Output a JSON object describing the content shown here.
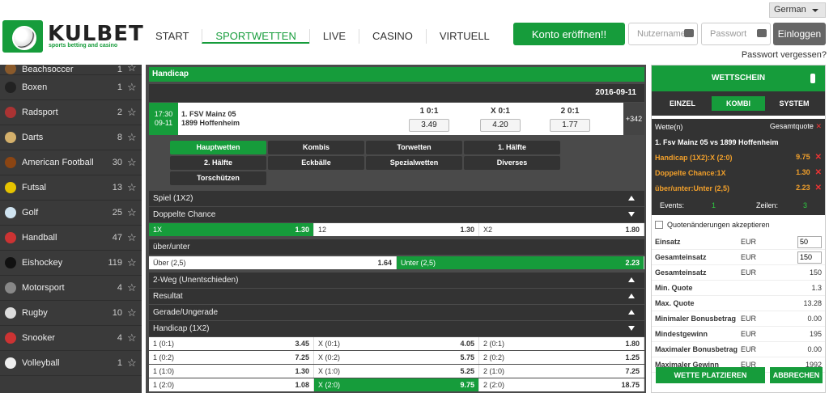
{
  "header": {
    "logo_text": "KULBET",
    "logo_tagline": "sports betting and casino",
    "nav": [
      {
        "label": "START",
        "active": false
      },
      {
        "label": "SPORTWETTEN",
        "active": true
      },
      {
        "label": "LIVE",
        "active": false
      },
      {
        "label": "CASINO",
        "active": false
      },
      {
        "label": "VIRTUELL",
        "active": false
      }
    ],
    "open_account": "Konto eröffnen!!",
    "username_placeholder": "Nutzername",
    "password_placeholder": "Passwort",
    "login_button": "Einloggen",
    "language": "German",
    "forgot_password": "Passwort vergessen?"
  },
  "sidebar": {
    "sports": [
      {
        "name": "Beachsoccer",
        "count": "1",
        "icon": "beachsoccer-icon",
        "color": "#8a5a2b"
      },
      {
        "name": "Boxen",
        "count": "1",
        "icon": "boxing-icon",
        "color": "#222222"
      },
      {
        "name": "Radsport",
        "count": "2",
        "icon": "cycling-icon",
        "color": "#a33"
      },
      {
        "name": "Darts",
        "count": "8",
        "icon": "darts-icon",
        "color": "#d4b06b"
      },
      {
        "name": "American Football",
        "count": "30",
        "icon": "american-football-icon",
        "color": "#8b4513"
      },
      {
        "name": "Futsal",
        "count": "13",
        "icon": "futsal-icon",
        "color": "#e6c300"
      },
      {
        "name": "Golf",
        "count": "25",
        "icon": "golf-icon",
        "color": "#cfe3f0"
      },
      {
        "name": "Handball",
        "count": "47",
        "icon": "handball-icon",
        "color": "#c33"
      },
      {
        "name": "Eishockey",
        "count": "119",
        "icon": "icehockey-icon",
        "color": "#111111"
      },
      {
        "name": "Motorsport",
        "count": "4",
        "icon": "motorsport-icon",
        "color": "#888888"
      },
      {
        "name": "Rugby",
        "count": "10",
        "icon": "rugby-icon",
        "color": "#dddddd"
      },
      {
        "name": "Snooker",
        "count": "4",
        "icon": "snooker-icon",
        "color": "#c33"
      },
      {
        "name": "Volleyball",
        "count": "1",
        "icon": "volleyball-icon",
        "color": "#eeeeee"
      }
    ]
  },
  "main": {
    "title": "Handicap",
    "date": "2016-09-11",
    "match": {
      "time": "17:30",
      "date": "09-11",
      "home": "1. FSV Mainz 05",
      "away": "1899 Hoffenheim",
      "odds": [
        {
          "label": "1 0:1",
          "value": "3.49"
        },
        {
          "label": "X 0:1",
          "value": "4.20"
        },
        {
          "label": "2 0:1",
          "value": "1.77"
        }
      ],
      "more": "+342"
    },
    "tabs": [
      {
        "label": "Hauptwetten",
        "active": true
      },
      {
        "label": "Kombis",
        "active": false
      },
      {
        "label": "Torwetten",
        "active": false
      },
      {
        "label": "1. Hälfte",
        "active": false
      },
      {
        "label": "2. Hälfte",
        "active": false
      },
      {
        "label": "Eckbälle",
        "active": false
      },
      {
        "label": "Spezialwetten",
        "active": false
      },
      {
        "label": "Diverses",
        "active": false
      },
      {
        "label": "Torschützen",
        "active": false
      }
    ],
    "markets": {
      "spiel": "Spiel (1X2)",
      "doppelte": "Doppelte Chance",
      "doppelte_odds": [
        {
          "label": "1X",
          "value": "1.30",
          "selected": true
        },
        {
          "label": "12",
          "value": "1.30",
          "selected": false
        },
        {
          "label": "X2",
          "value": "1.80",
          "selected": false
        }
      ],
      "ueber": "über/unter",
      "ueber_odds": [
        {
          "label": "Über (2,5)",
          "value": "1.64",
          "selected": false
        },
        {
          "label": "Unter (2,5)",
          "value": "2.23",
          "selected": true
        }
      ],
      "zweiweg": "2-Weg (Unentschieden)",
      "resultat": "Resultat",
      "gerade": "Gerade/Ungerade",
      "handicap": "Handicap (1X2)",
      "handicap_rows": [
        [
          {
            "label": "1 (0:1)",
            "value": "3.45",
            "selected": false
          },
          {
            "label": "X (0:1)",
            "value": "4.05",
            "selected": false
          },
          {
            "label": "2 (0:1)",
            "value": "1.80",
            "selected": false
          }
        ],
        [
          {
            "label": "1 (0:2)",
            "value": "7.25",
            "selected": false
          },
          {
            "label": "X (0:2)",
            "value": "5.75",
            "selected": false
          },
          {
            "label": "2 (0:2)",
            "value": "1.25",
            "selected": false
          }
        ],
        [
          {
            "label": "1 (1:0)",
            "value": "1.30",
            "selected": false
          },
          {
            "label": "X (1:0)",
            "value": "5.25",
            "selected": false
          },
          {
            "label": "2 (1:0)",
            "value": "7.25",
            "selected": false
          }
        ],
        [
          {
            "label": "1 (2:0)",
            "value": "1.08",
            "selected": false
          },
          {
            "label": "X (2:0)",
            "value": "9.75",
            "selected": true
          },
          {
            "label": "2 (2:0)",
            "value": "18.75",
            "selected": false
          }
        ]
      ]
    }
  },
  "betslip": {
    "title": "WETTSCHEIN",
    "tabs": [
      {
        "label": "EINZEL",
        "active": false
      },
      {
        "label": "KOMBI",
        "active": true
      },
      {
        "label": "SYSTEM",
        "active": false
      }
    ],
    "header_left": "Wette(n)",
    "header_right": "Gesamtquote",
    "match": "1. Fsv Mainz 05 vs 1899 Hoffenheim",
    "selections": [
      {
        "label": "Handicap (1X2):X (2:0)",
        "value": "9.75"
      },
      {
        "label": "Doppelte Chance:1X",
        "value": "1.30"
      },
      {
        "label": "über/unter:Unter (2,5)",
        "value": "2.23"
      }
    ],
    "events_label": "Events:",
    "events_value": "1",
    "lines_label": "Zeilen:",
    "lines_value": "3",
    "accept_changes": "Quotenänderungen akzeptieren",
    "calc": [
      {
        "label": "Einsatz",
        "unit": "EUR",
        "value": "50",
        "input": true
      },
      {
        "label": "Gesamteinsatz",
        "unit": "EUR",
        "value": "150",
        "input": true
      },
      {
        "label": "Gesamteinsatz",
        "unit": "EUR",
        "value": "150",
        "input": false
      },
      {
        "label": "Min. Quote",
        "unit": "",
        "value": "1.3",
        "input": false
      },
      {
        "label": "Max. Quote",
        "unit": "",
        "value": "13.28",
        "input": false
      },
      {
        "label": "Minimaler Bonusbetrag",
        "unit": "EUR",
        "value": "0.00",
        "input": false
      },
      {
        "label": "Mindestgewinn",
        "unit": "EUR",
        "value": "195",
        "input": false
      },
      {
        "label": "Maximaler Bonusbetrag",
        "unit": "EUR",
        "value": "0.00",
        "input": false
      },
      {
        "label": "Maximaler Gewinn",
        "unit": "EUR",
        "value": "1992",
        "input": false
      }
    ],
    "place_bet": "WETTE PLATZIEREN",
    "cancel": "ABBRECHEN"
  },
  "colors": {
    "brand_green": "#169c3b",
    "dark": "#333333",
    "selection_orange": "#f2a02b",
    "remove_red": "#e33"
  }
}
